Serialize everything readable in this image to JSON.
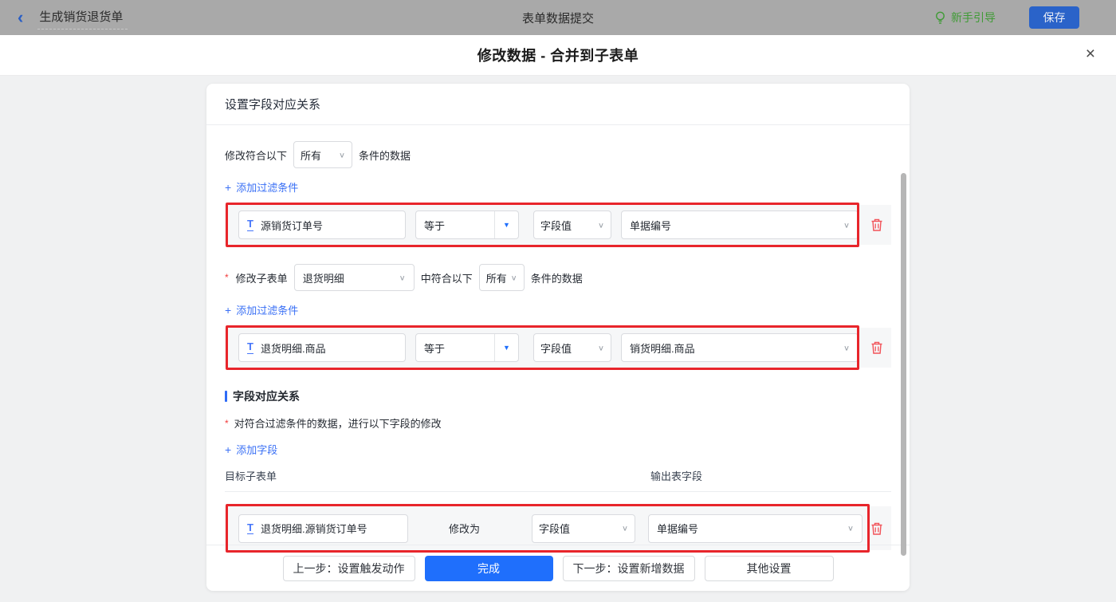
{
  "icons": {
    "back": "‹",
    "plus": "+",
    "chevron_down": "∨",
    "caret_down": "▼",
    "close": "×",
    "required": "*",
    "text_field": "T"
  },
  "topbar": {
    "back_title": "生成销货退货单",
    "center_title": "表单数据提交",
    "guide_label": "新手引导",
    "save_label": "保存"
  },
  "modal": {
    "title": "修改数据 - 合并到子表单"
  },
  "panel": {
    "title": "设置字段对应关系",
    "filter1": {
      "prefix": "修改符合以下",
      "mode": "所有",
      "suffix": "条件的数据",
      "add_label": "添加过滤条件",
      "row": {
        "field": "源销货订单号",
        "operator": "等于",
        "value_type": "字段值",
        "value": "单据编号"
      }
    },
    "filter2": {
      "label": "修改子表单",
      "subform": "退货明细",
      "mid": "中符合以下",
      "mode": "所有",
      "suffix": "条件的数据",
      "add_label": "添加过滤条件",
      "row": {
        "field": "退货明细.商品",
        "operator": "等于",
        "value_type": "字段值",
        "value": "销货明细.商品"
      }
    },
    "mapping": {
      "section_title": "字段对应关系",
      "desc": "对符合过滤条件的数据，进行以下字段的修改",
      "add_label": "添加字段",
      "col_target": "目标子表单",
      "col_output": "输出表字段",
      "row": {
        "field": "退货明细.源销货订单号",
        "mid_label": "修改为",
        "value_type": "字段值",
        "value": "单据编号"
      }
    }
  },
  "footer": {
    "prev_label": "上一步：设置触发动作",
    "done_label": "完成",
    "next_label": "下一步：设置新增数据",
    "other_label": "其他设置"
  },
  "colors": {
    "accent_blue": "#1f6ffc",
    "link_blue": "#3a70f5",
    "annotation_red": "#e8252b",
    "danger_red": "#f25258",
    "guide_green": "#3f9b35",
    "topbar_gray": "#a9a9a9"
  }
}
